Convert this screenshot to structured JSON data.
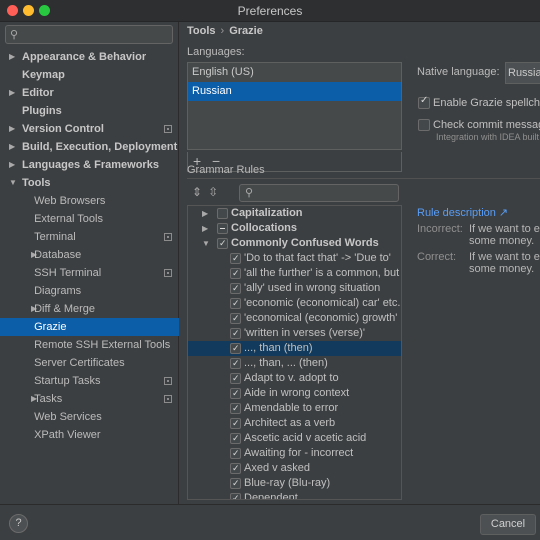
{
  "window": {
    "title": "Preferences"
  },
  "sidebar": {
    "search_placeholder": "",
    "items": [
      {
        "label": "Appearance & Behavior",
        "level": 0,
        "bold": true,
        "arrow": "▶",
        "proj": false
      },
      {
        "label": "Keymap",
        "level": 0,
        "bold": true,
        "arrow": "",
        "proj": false
      },
      {
        "label": "Editor",
        "level": 0,
        "bold": true,
        "arrow": "▶",
        "proj": false
      },
      {
        "label": "Plugins",
        "level": 0,
        "bold": true,
        "arrow": "",
        "proj": false
      },
      {
        "label": "Version Control",
        "level": 0,
        "bold": true,
        "arrow": "▶",
        "proj": true
      },
      {
        "label": "Build, Execution, Deployment",
        "level": 0,
        "bold": true,
        "arrow": "▶",
        "proj": false
      },
      {
        "label": "Languages & Frameworks",
        "level": 0,
        "bold": true,
        "arrow": "▶",
        "proj": false
      },
      {
        "label": "Tools",
        "level": 0,
        "bold": true,
        "arrow": "▼",
        "proj": false
      },
      {
        "label": "Web Browsers",
        "level": 1,
        "bold": false,
        "arrow": "",
        "proj": false
      },
      {
        "label": "External Tools",
        "level": 1,
        "bold": false,
        "arrow": "",
        "proj": false
      },
      {
        "label": "Terminal",
        "level": 1,
        "bold": false,
        "arrow": "",
        "proj": true
      },
      {
        "label": "Database",
        "level": 1,
        "bold": false,
        "arrow": "▶",
        "proj": false
      },
      {
        "label": "SSH Terminal",
        "level": 1,
        "bold": false,
        "arrow": "",
        "proj": true
      },
      {
        "label": "Diagrams",
        "level": 1,
        "bold": false,
        "arrow": "",
        "proj": false
      },
      {
        "label": "Diff & Merge",
        "level": 1,
        "bold": false,
        "arrow": "▶",
        "proj": false
      },
      {
        "label": "Grazie",
        "level": 1,
        "bold": false,
        "arrow": "",
        "proj": false,
        "selected": true
      },
      {
        "label": "Remote SSH External Tools",
        "level": 1,
        "bold": false,
        "arrow": "",
        "proj": false
      },
      {
        "label": "Server Certificates",
        "level": 1,
        "bold": false,
        "arrow": "",
        "proj": false
      },
      {
        "label": "Startup Tasks",
        "level": 1,
        "bold": false,
        "arrow": "",
        "proj": true
      },
      {
        "label": "Tasks",
        "level": 1,
        "bold": false,
        "arrow": "▶",
        "proj": true
      },
      {
        "label": "Web Services",
        "level": 1,
        "bold": false,
        "arrow": "",
        "proj": false
      },
      {
        "label": "XPath Viewer",
        "level": 1,
        "bold": false,
        "arrow": "",
        "proj": false
      }
    ]
  },
  "breadcrumb": {
    "parent": "Tools",
    "separator": "›",
    "current": "Grazie"
  },
  "languages": {
    "label": "Languages:",
    "items": [
      {
        "label": "English (US)",
        "selected": false
      },
      {
        "label": "Russian",
        "selected": true
      }
    ],
    "add": "+",
    "remove": "−"
  },
  "native": {
    "label": "Native language:",
    "value": "Russian"
  },
  "options": {
    "spellcheck_label": "Enable Grazie spellche",
    "spellcheck_checked": true,
    "commit_label": "Check commit messag",
    "commit_checked": false,
    "commit_sub": "Integration with IDEA built"
  },
  "grammar": {
    "label": "Grammar Rules",
    "search_placeholder": "",
    "rules": [
      {
        "text": "Capitalization",
        "type": "cat",
        "tri": "▶",
        "state": "off"
      },
      {
        "text": "Collocations",
        "type": "cat",
        "tri": "▶",
        "state": "partial"
      },
      {
        "text": "Commonly Confused Words",
        "type": "cat",
        "tri": "▼",
        "state": "on"
      },
      {
        "text": "'Do to that fact that' -> 'Due to'",
        "type": "rule",
        "state": "on"
      },
      {
        "text": "'all the further' is a common, but",
        "type": "rule",
        "state": "on"
      },
      {
        "text": "'ally' used in wrong situation",
        "type": "rule",
        "state": "on"
      },
      {
        "text": "'economic (economical) car' etc.",
        "type": "rule",
        "state": "on"
      },
      {
        "text": "'economical (economic) growth'",
        "type": "rule",
        "state": "on"
      },
      {
        "text": "'written in verses (verse)'",
        "type": "rule",
        "state": "on"
      },
      {
        "text": "..., than (then)",
        "type": "rule",
        "state": "on",
        "selected": true
      },
      {
        "text": "..., than, ... (then)",
        "type": "rule",
        "state": "on"
      },
      {
        "text": "Adapt to v. adopt to",
        "type": "rule",
        "state": "on"
      },
      {
        "text": "Aide in wrong context",
        "type": "rule",
        "state": "on"
      },
      {
        "text": "Amendable to error",
        "type": "rule",
        "state": "on"
      },
      {
        "text": "Architect as a verb",
        "type": "rule",
        "state": "on"
      },
      {
        "text": "Ascetic acid v acetic acid",
        "type": "rule",
        "state": "on"
      },
      {
        "text": "Awaiting for - incorrect",
        "type": "rule",
        "state": "on"
      },
      {
        "text": "Axed v asked",
        "type": "rule",
        "state": "on"
      },
      {
        "text": "Blue-ray (Blu-ray)",
        "type": "rule",
        "state": "on"
      },
      {
        "text": "Dependent",
        "type": "rule",
        "state": "on"
      }
    ]
  },
  "description": {
    "link": "Rule description ↗",
    "incorrect_label": "Incorrect:",
    "incorrect_value": "If we want to ea some money.",
    "correct_label": "Correct:",
    "correct_value": "If we want to ea some money."
  },
  "footer": {
    "help": "?",
    "cancel": "Cancel"
  }
}
